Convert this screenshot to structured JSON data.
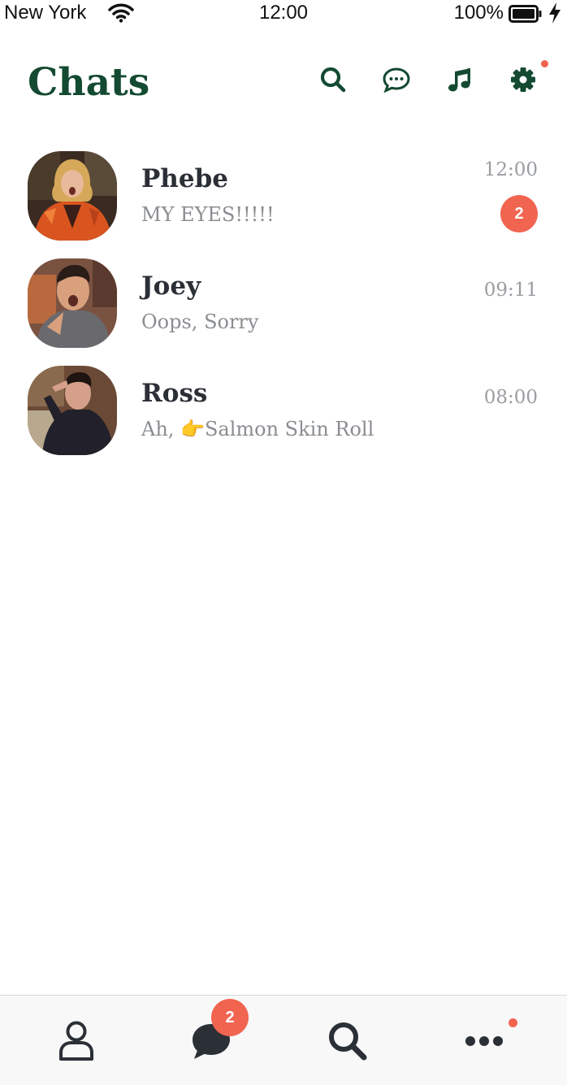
{
  "status_bar": {
    "carrier": "New York",
    "time": "12:00",
    "battery": "100%"
  },
  "header": {
    "title": "Chats",
    "icons": [
      "search-icon",
      "chat-bubble-icon",
      "music-note-icon",
      "settings-gear-icon"
    ]
  },
  "chats": [
    {
      "name": "Phebe",
      "preview": "MY EYES!!!!!",
      "time": "12:00",
      "unread": "2"
    },
    {
      "name": "Joey",
      "preview": "Oops, Sorry",
      "time": "09:11"
    },
    {
      "name": "Ross",
      "preview_prefix": "Ah, ",
      "preview_emoji": "👉",
      "preview_rest": "Salmon Skin Roll",
      "time": "08:00"
    }
  ],
  "tab_bar": {
    "tabs": [
      "profile-icon",
      "chats-icon",
      "search-icon",
      "more-icon"
    ],
    "chats_badge": "2"
  },
  "colors": {
    "brand": "#134a31",
    "badge": "#f06450",
    "text": "#2b2f36",
    "muted": "#8a8d91"
  }
}
